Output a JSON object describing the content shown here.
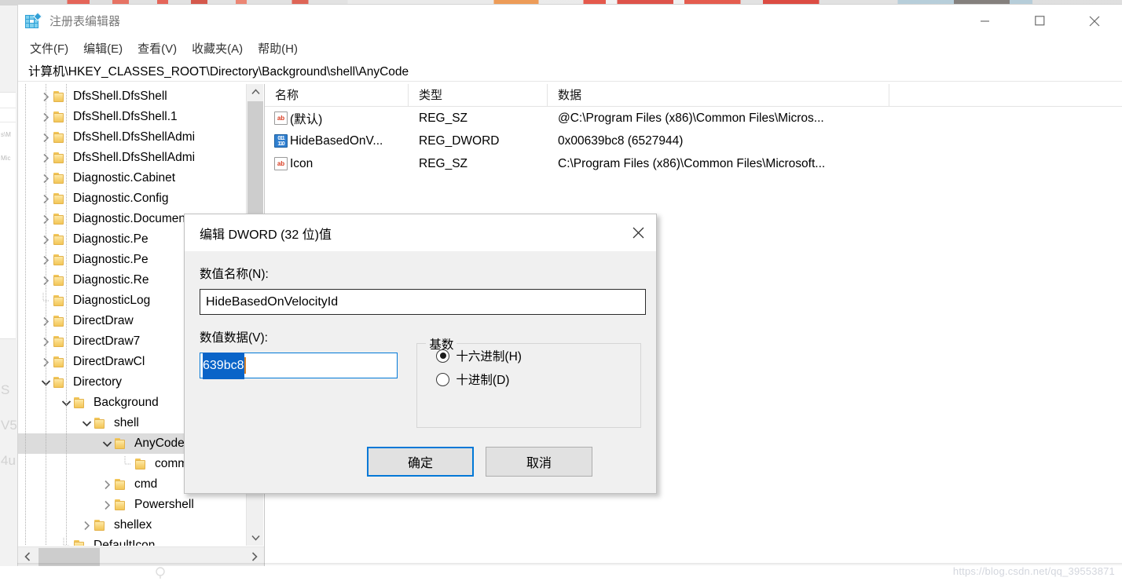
{
  "window": {
    "title": "注册表编辑器",
    "icon": "registry-icon",
    "controls": {
      "minimize": "最小化",
      "maximize": "最大化",
      "close": "关闭"
    }
  },
  "menu": {
    "items": [
      {
        "label": "文件(F)",
        "name": "menu-file"
      },
      {
        "label": "编辑(E)",
        "name": "menu-edit"
      },
      {
        "label": "查看(V)",
        "name": "menu-view"
      },
      {
        "label": "收藏夹(A)",
        "name": "menu-favorites"
      },
      {
        "label": "帮助(H)",
        "name": "menu-help"
      }
    ]
  },
  "address": {
    "path": "计算机\\HKEY_CLASSES_ROOT\\Directory\\Background\\shell\\AnyCode"
  },
  "tree": {
    "items": [
      {
        "label": "DfsShell.DfsShell",
        "indent": 2,
        "twisty": "collapsed",
        "selected": false
      },
      {
        "label": "DfsShell.DfsShell.1",
        "indent": 2,
        "twisty": "collapsed",
        "selected": false
      },
      {
        "label": "DfsShell.DfsShellAdmi",
        "indent": 2,
        "twisty": "collapsed",
        "selected": false
      },
      {
        "label": "DfsShell.DfsShellAdmi",
        "indent": 2,
        "twisty": "collapsed",
        "selected": false
      },
      {
        "label": "Diagnostic.Cabinet",
        "indent": 2,
        "twisty": "collapsed",
        "selected": false
      },
      {
        "label": "Diagnostic.Config",
        "indent": 2,
        "twisty": "collapsed",
        "selected": false
      },
      {
        "label": "Diagnostic.Document",
        "indent": 2,
        "twisty": "collapsed",
        "selected": false
      },
      {
        "label": "Diagnostic.Pe",
        "indent": 2,
        "twisty": "collapsed",
        "selected": false
      },
      {
        "label": "Diagnostic.Pe",
        "indent": 2,
        "twisty": "collapsed",
        "selected": false
      },
      {
        "label": "Diagnostic.Re",
        "indent": 2,
        "twisty": "collapsed",
        "selected": false
      },
      {
        "label": "DiagnosticLog",
        "indent": 2,
        "twisty": "none",
        "selected": false
      },
      {
        "label": "DirectDraw",
        "indent": 2,
        "twisty": "collapsed",
        "selected": false
      },
      {
        "label": "DirectDraw7",
        "indent": 2,
        "twisty": "collapsed",
        "selected": false
      },
      {
        "label": "DirectDrawCl",
        "indent": 2,
        "twisty": "collapsed",
        "selected": false
      },
      {
        "label": "Directory",
        "indent": 2,
        "twisty": "expanded",
        "selected": false
      },
      {
        "label": "Background",
        "indent": 3,
        "twisty": "expanded",
        "selected": false
      },
      {
        "label": "shell",
        "indent": 4,
        "twisty": "expanded",
        "selected": false
      },
      {
        "label": "AnyCode",
        "indent": 5,
        "twisty": "expanded",
        "selected": true
      },
      {
        "label": "command",
        "indent": 6,
        "twisty": "none",
        "selected": false
      },
      {
        "label": "cmd",
        "indent": 5,
        "twisty": "collapsed",
        "selected": false
      },
      {
        "label": "Powershell",
        "indent": 5,
        "twisty": "collapsed",
        "selected": false
      },
      {
        "label": "shellex",
        "indent": 4,
        "twisty": "collapsed",
        "selected": false
      },
      {
        "label": "DefaultIcon",
        "indent": 3,
        "twisty": "none",
        "selected": false
      }
    ]
  },
  "list": {
    "columns": [
      "名称",
      "类型",
      "数据"
    ],
    "rows": [
      {
        "icon": "string-value-icon",
        "name": "(默认)",
        "type": "REG_SZ",
        "data": "@C:\\Program Files (x86)\\Common Files\\Micros..."
      },
      {
        "icon": "dword-value-icon",
        "name": "HideBasedOnV...",
        "type": "REG_DWORD",
        "data": "0x00639bc8 (6527944)"
      },
      {
        "icon": "string-value-icon",
        "name": "Icon",
        "type": "REG_SZ",
        "data": "C:\\Program Files (x86)\\Common Files\\Microsoft..."
      }
    ]
  },
  "dialog": {
    "title": "编辑 DWORD (32 位)值",
    "close_label": "关闭",
    "name_label": "数值名称(N):",
    "name_value": "HideBasedOnVelocityId",
    "data_label": "数值数据(V):",
    "data_value": "639bc8",
    "radix": {
      "group_label": "基数",
      "options": [
        {
          "label": "十六进制(H)",
          "checked": true
        },
        {
          "label": "十进制(D)",
          "checked": false
        }
      ]
    },
    "buttons": {
      "ok": "确定",
      "cancel": "取消"
    }
  },
  "watermark": {
    "text": "https://blog.csdn.net/qq_39553871"
  },
  "background_fragments": {
    "left_snippets": [
      "s\\M",
      "Mic",
      "S",
      "V5",
      "4u"
    ]
  },
  "colors": {
    "accent": "#0078d7",
    "selection": "#0a64c8",
    "tree_selected": "#dcdcdc",
    "folder": "#f2c659",
    "dword_icon": "#2f7fd0",
    "sz_icon": "#d83b20"
  }
}
